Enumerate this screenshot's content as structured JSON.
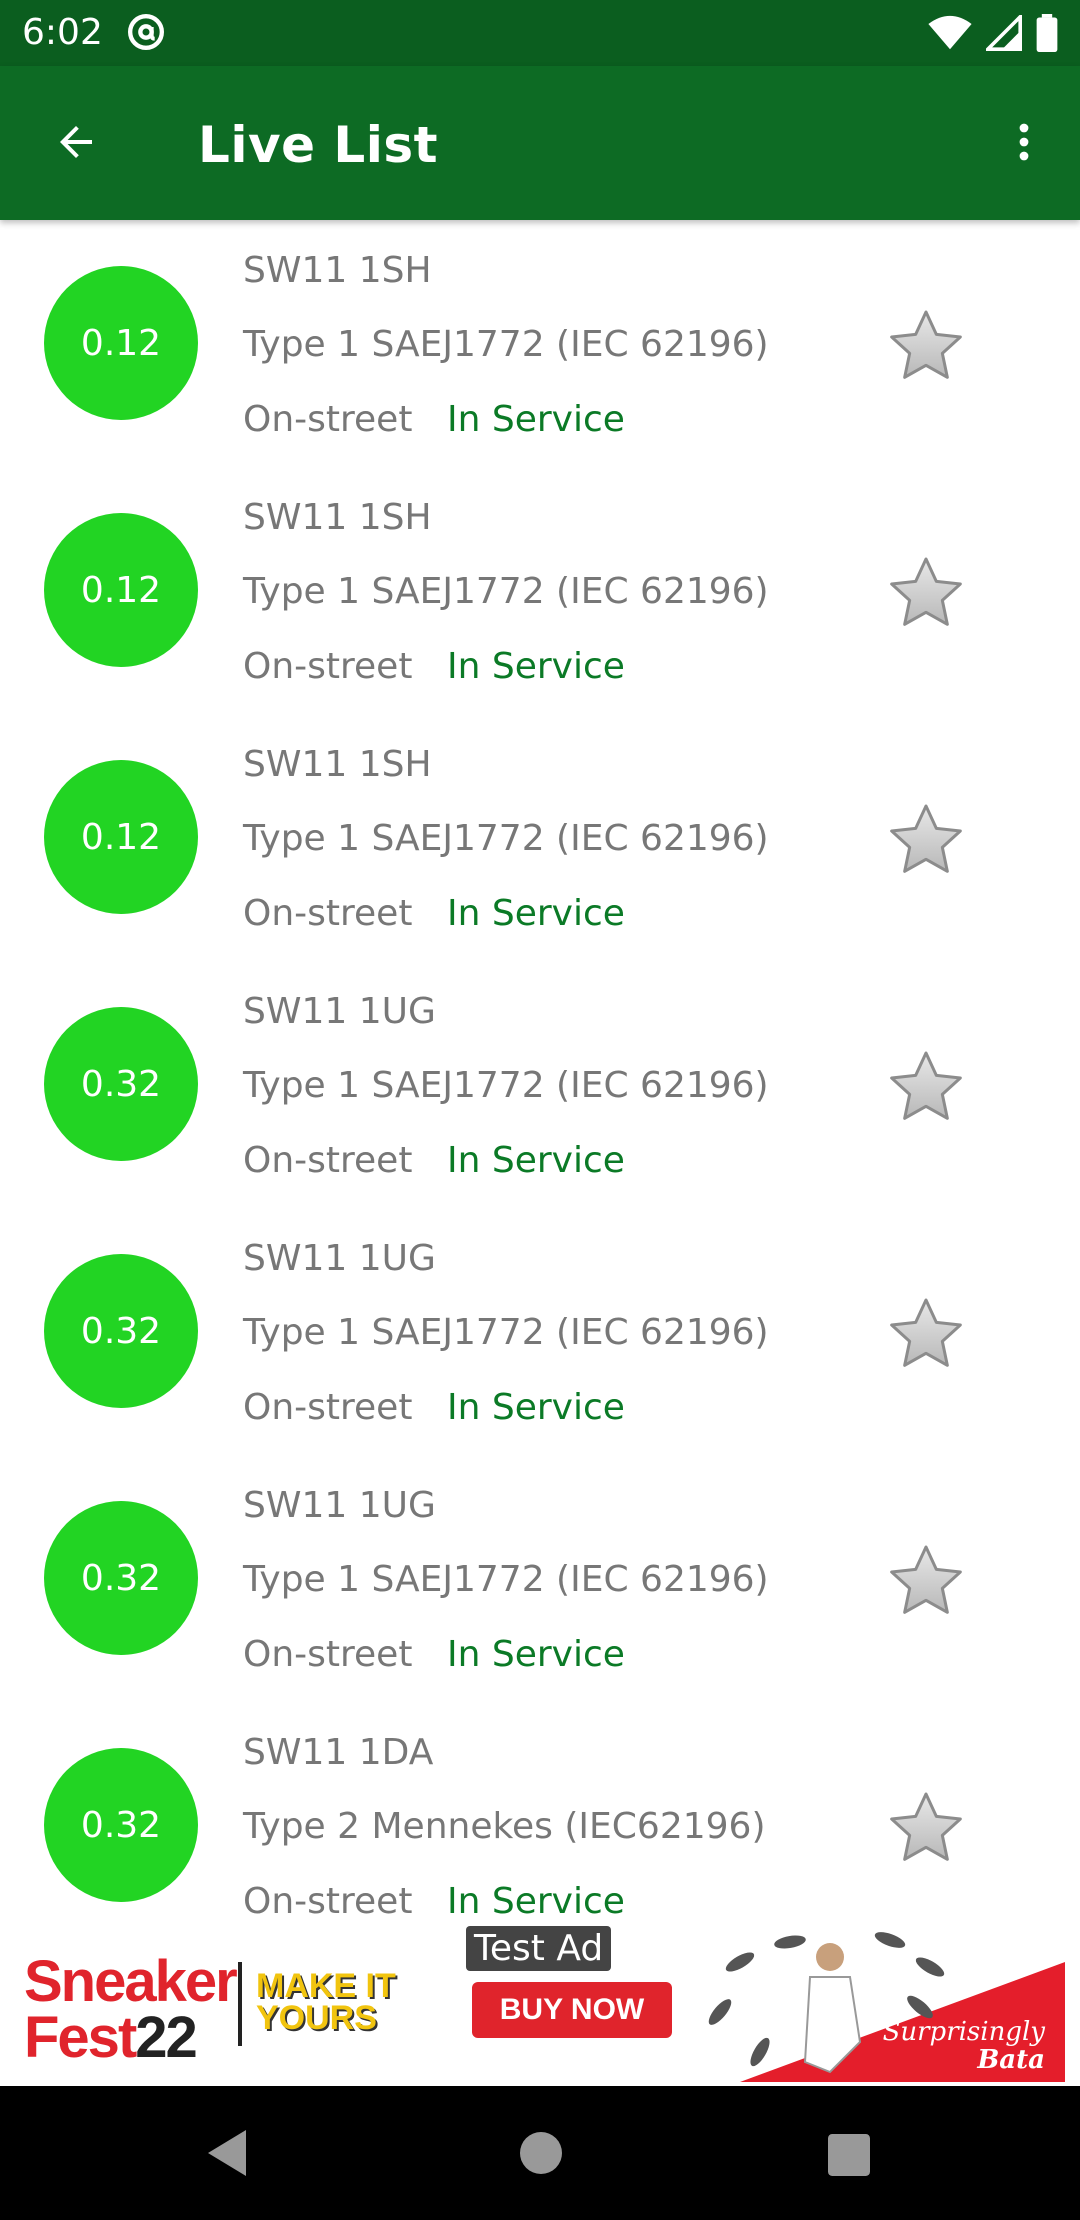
{
  "status_bar": {
    "time": "6:02"
  },
  "app_bar": {
    "title": "Live List"
  },
  "list": [
    {
      "distance": "0.12",
      "postcode": "SW11 1SH",
      "connector": "Type 1 SAEJ1772 (IEC 62196)",
      "location": "On-street",
      "status": "In Service"
    },
    {
      "distance": "0.12",
      "postcode": "SW11 1SH",
      "connector": "Type 1 SAEJ1772 (IEC 62196)",
      "location": "On-street",
      "status": "In Service"
    },
    {
      "distance": "0.12",
      "postcode": "SW11 1SH",
      "connector": "Type 1 SAEJ1772 (IEC 62196)",
      "location": "On-street",
      "status": "In Service"
    },
    {
      "distance": "0.32",
      "postcode": "SW11 1UG",
      "connector": "Type 1 SAEJ1772 (IEC 62196)",
      "location": "On-street",
      "status": "In Service"
    },
    {
      "distance": "0.32",
      "postcode": "SW11 1UG",
      "connector": "Type 1 SAEJ1772 (IEC 62196)",
      "location": "On-street",
      "status": "In Service"
    },
    {
      "distance": "0.32",
      "postcode": "SW11 1UG",
      "connector": "Type 1 SAEJ1772 (IEC 62196)",
      "location": "On-street",
      "status": "In Service"
    },
    {
      "distance": "0.32",
      "postcode": "SW11 1DA",
      "connector": "Type 2 Mennekes (IEC62196)",
      "location": "On-street",
      "status": "In Service"
    }
  ],
  "ad": {
    "label": "Test Ad",
    "brand_line1": "Sneaker",
    "brand_line2": "Fest",
    "brand_num": "22",
    "tagline_line1": "MAKE IT",
    "tagline_line2": "YOURS",
    "cta": "BUY NOW",
    "sponsor_line1": "Surprisingly",
    "sponsor_line2": "Bata"
  },
  "colors": {
    "status_bar": "#0b5e1f",
    "app_bar": "#0d6b24",
    "distance_badge": "#22d423",
    "status_text": "#0b7a26"
  }
}
